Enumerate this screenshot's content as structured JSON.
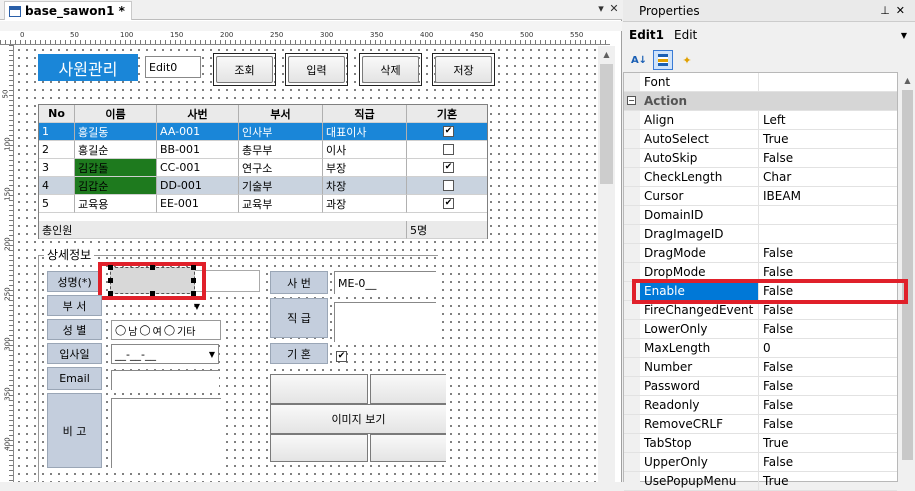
{
  "designer": {
    "tab_title": "base_sawon1 *",
    "pin_glyph": "▾",
    "close_glyph": "✕",
    "ruler_h": [
      "0",
      "50",
      "100",
      "150",
      "200",
      "250",
      "300",
      "350",
      "400",
      "450",
      "500",
      "550"
    ],
    "ruler_v": [
      "50",
      "100",
      "150",
      "200",
      "250",
      "300",
      "350",
      "400"
    ]
  },
  "form": {
    "title": "사원관리",
    "edit0": "Edit0",
    "buttons": {
      "search": "조회",
      "input": "입력",
      "delete": "삭제",
      "save": "저장"
    },
    "grid": {
      "headers": [
        "No",
        "이름",
        "사번",
        "부서",
        "직급",
        "기혼"
      ],
      "rows": [
        {
          "no": "1",
          "name": "홍길동",
          "id": "AA-001",
          "dept": "인사부",
          "rank": "대표이사",
          "married": "✔"
        },
        {
          "no": "2",
          "name": "홍길순",
          "id": "BB-001",
          "dept": "총무부",
          "rank": "이사",
          "married": ""
        },
        {
          "no": "3",
          "name": "김갑돌",
          "id": "CC-001",
          "dept": "연구소",
          "rank": "부장",
          "married": "✔"
        },
        {
          "no": "4",
          "name": "김갑순",
          "id": "DD-001",
          "dept": "기술부",
          "rank": "차장",
          "married": ""
        },
        {
          "no": "5",
          "name": "교육용",
          "id": "EE-001",
          "dept": "교육부",
          "rank": "과장",
          "married": "✔"
        }
      ],
      "footer_label": "총인원",
      "footer_count": "5명"
    },
    "detail": {
      "group_label": "상세정보",
      "name_label": "성명(*)",
      "dept_label": "부 서",
      "gender_label": "성 별",
      "gender_options": [
        "남",
        "여",
        "기타"
      ],
      "hire_label": "입사일",
      "hire_mask": "__-__-__",
      "email_label": "Email",
      "note_label": "비 고",
      "emp_no_label": "사 번",
      "emp_no_value": "ME-0__",
      "rank_label": "직 급",
      "married_label": "기 혼",
      "married_check": "✔",
      "image_button": "이미지 보기"
    }
  },
  "properties": {
    "title": "Properties",
    "pin_glyph": "ᵖ",
    "close_glyph": "✕",
    "object_name": "Edit1",
    "object_type": "Edit",
    "category": "Action",
    "rows": [
      {
        "name": "Font",
        "value": ""
      },
      {
        "name": "Align",
        "value": "Left"
      },
      {
        "name": "AutoSelect",
        "value": "True"
      },
      {
        "name": "AutoSkip",
        "value": "False"
      },
      {
        "name": "CheckLength",
        "value": "Char"
      },
      {
        "name": "Cursor",
        "value": "IBEAM"
      },
      {
        "name": "DomainID",
        "value": ""
      },
      {
        "name": "DragImageID",
        "value": ""
      },
      {
        "name": "DragMode",
        "value": "False"
      },
      {
        "name": "DropMode",
        "value": "False"
      },
      {
        "name": "Enable",
        "value": "False"
      },
      {
        "name": "FireChangedEvent",
        "value": "False"
      },
      {
        "name": "LowerOnly",
        "value": "False"
      },
      {
        "name": "MaxLength",
        "value": "0"
      },
      {
        "name": "Number",
        "value": "False"
      },
      {
        "name": "Password",
        "value": "False"
      },
      {
        "name": "Readonly",
        "value": "False"
      },
      {
        "name": "RemoveCRLF",
        "value": "False"
      },
      {
        "name": "TabStop",
        "value": "True"
      },
      {
        "name": "UpperOnly",
        "value": "False"
      },
      {
        "name": "UsePopupMenu",
        "value": "True"
      }
    ],
    "selected": "Enable",
    "colors": {
      "highlight": "#e0202a",
      "selection": "#0078d7"
    }
  }
}
